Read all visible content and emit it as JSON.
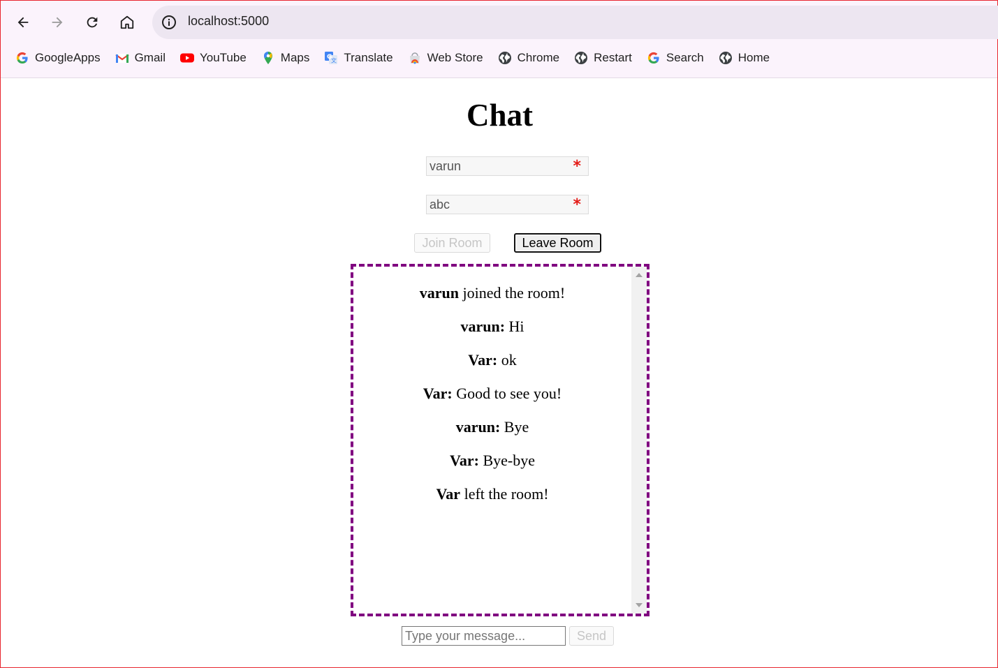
{
  "browser": {
    "url": "localhost:5000",
    "bookmarks": [
      {
        "label": "GoogleApps",
        "icon": "google-g-icon"
      },
      {
        "label": "Gmail",
        "icon": "gmail-icon"
      },
      {
        "label": "YouTube",
        "icon": "youtube-icon"
      },
      {
        "label": "Maps",
        "icon": "maps-pin-icon"
      },
      {
        "label": "Translate",
        "icon": "translate-icon"
      },
      {
        "label": "Web Store",
        "icon": "web-store-icon"
      },
      {
        "label": "Chrome",
        "icon": "globe-icon"
      },
      {
        "label": "Restart",
        "icon": "globe-icon"
      },
      {
        "label": "Search",
        "icon": "google-g-icon"
      },
      {
        "label": "Home",
        "icon": "globe-icon"
      }
    ]
  },
  "page": {
    "title": "Chat",
    "username": {
      "value": "varun",
      "required_mark": "*"
    },
    "room": {
      "value": "abc",
      "required_mark": "*"
    },
    "join_label": "Join Room",
    "leave_label": "Leave Room",
    "messages": [
      {
        "sender": "varun",
        "text": " joined the room!"
      },
      {
        "sender": "varun:",
        "text": " Hi"
      },
      {
        "sender": "Var:",
        "text": " ok"
      },
      {
        "sender": "Var:",
        "text": " Good to see you!"
      },
      {
        "sender": "varun:",
        "text": " Bye"
      },
      {
        "sender": "Var:",
        "text": " Bye-bye"
      },
      {
        "sender": "Var",
        "text": " left the room!"
      }
    ],
    "message_placeholder": "Type your message...",
    "send_label": "Send"
  },
  "colors": {
    "chat_border": "#800080",
    "required": "#e41b17",
    "toolbar_bg": "#fbf3fc"
  }
}
